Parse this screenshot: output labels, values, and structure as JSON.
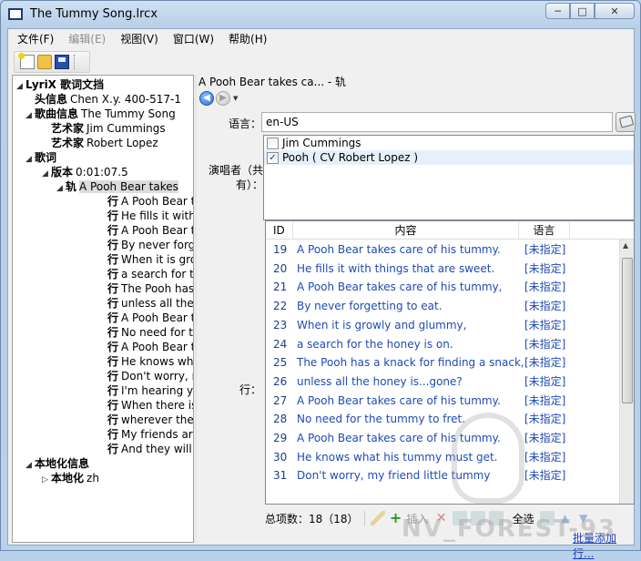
{
  "window": {
    "title": "The Tummy Song.lrcx",
    "buttons": {
      "minimize": "─",
      "maximize": "□",
      "close": "✕"
    }
  },
  "menu": [
    "文件(F)",
    "编辑(E)",
    "视图(V)",
    "窗口(W)",
    "帮助(H)"
  ],
  "menu_disabled": [
    false,
    true,
    false,
    false,
    false
  ],
  "toolbar": {
    "icons": [
      "new-icon",
      "open-folder-icon",
      "save-icon"
    ]
  },
  "tree": {
    "root": "LyriX 歌词文挡",
    "header_tag": "头信息",
    "header_value": "Chen X.y. 400-517-1",
    "song_tag": "歌曲信息",
    "song_value": "The Tummy Song",
    "artist_tag": "艺术家",
    "artist1": "Jim Cummings",
    "artist2": "Robert Lopez",
    "lyrics_tag": "歌词",
    "version_tag": "版本",
    "version_value": "0:01:07.5",
    "track_tag": "轨",
    "track_value": "A Pooh Bear takes",
    "line_tag": "行",
    "lines": [
      "A Pooh Bear ta",
      "He fills it with th",
      "A Pooh Bear ta",
      "By never forge",
      "When it is grov",
      "a search for the",
      "The Pooh has a",
      "unless all the h",
      "A Pooh Bear ta",
      "No need for th",
      "A Pooh Bear ta",
      "He knows what",
      "Don't worry, m",
      "I'm hearing you",
      "When there is",
      "wherever the h",
      "My friends are",
      "And they will ta"
    ],
    "localization_tag": "本地化信息",
    "localization_sub_tag": "本地化",
    "localization_sub_value": "zh"
  },
  "detail": {
    "path": "A Pooh Bear takes ca... - 轨",
    "language_label": "语言：",
    "language_value": "en-US",
    "singers_label": "演唱者（共有）：",
    "singers": [
      {
        "name": "Jim Cummings",
        "checked": false
      },
      {
        "name": "Pooh ( CV Robert Lopez )",
        "checked": true
      }
    ],
    "lines_label": "行："
  },
  "lines_table": {
    "columns": [
      "ID",
      "内容",
      "语言"
    ],
    "rows": [
      {
        "id": "19",
        "content": "A Pooh Bear takes care of his tummy.",
        "lang": "[未指定]"
      },
      {
        "id": "20",
        "content": "He fills it with things that are sweet.",
        "lang": "[未指定]"
      },
      {
        "id": "21",
        "content": "A Pooh Bear takes care of his tummy,",
        "lang": "[未指定]"
      },
      {
        "id": "22",
        "content": "By never forgetting to eat.",
        "lang": "[未指定]"
      },
      {
        "id": "23",
        "content": "When it is growly and glummy,",
        "lang": "[未指定]"
      },
      {
        "id": "24",
        "content": "a search for the honey is on.",
        "lang": "[未指定]"
      },
      {
        "id": "25",
        "content": "The Pooh has a knack for finding a snack,",
        "lang": "[未指定]"
      },
      {
        "id": "26",
        "content": "unless all the honey is...gone?",
        "lang": "[未指定]"
      },
      {
        "id": "27",
        "content": "A Pooh Bear takes care of his tummy.",
        "lang": "[未指定]"
      },
      {
        "id": "28",
        "content": "No need for the tummy to fret.",
        "lang": "[未指定]"
      },
      {
        "id": "29",
        "content": "A Pooh Bear takes care of his tummy.",
        "lang": "[未指定]"
      },
      {
        "id": "30",
        "content": "He knows what his tummy must get.",
        "lang": "[未指定]"
      },
      {
        "id": "31",
        "content": "Don't worry, my friend little tummy",
        "lang": "[未指定]"
      }
    ]
  },
  "bottom": {
    "total": "总项数：18（18）",
    "insert": "插入",
    "select_all": "全选",
    "batch_add": "批量添加行..."
  },
  "watermark": "NV_FOREST-93"
}
